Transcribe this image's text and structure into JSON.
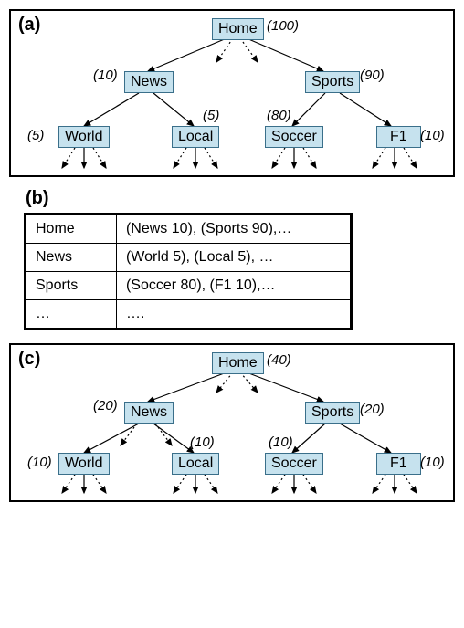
{
  "panels": {
    "a": {
      "label": "(a)",
      "nodes": {
        "home": {
          "text": "Home",
          "annot": "(100)"
        },
        "news": {
          "text": "News",
          "annot": "(10)"
        },
        "sports": {
          "text": "Sports",
          "annot": "(90)"
        },
        "world": {
          "text": "World",
          "annot": "(5)"
        },
        "local": {
          "text": "Local",
          "annot": "(5)"
        },
        "soccer": {
          "text": "Soccer",
          "annot": "(80)"
        },
        "f1": {
          "text": "F1",
          "annot": "(10)"
        }
      }
    },
    "b": {
      "label": "(b)",
      "rows": [
        {
          "key": "Home",
          "val": "(News 10), (Sports 90),…"
        },
        {
          "key": "News",
          "val": "(World 5), (Local 5), …"
        },
        {
          "key": "Sports",
          "val": "(Soccer 80), (F1 10),…"
        },
        {
          "key": "…",
          "val": "…."
        }
      ]
    },
    "c": {
      "label": "(c)",
      "nodes": {
        "home": {
          "text": "Home",
          "annot": "(40)"
        },
        "news": {
          "text": "News",
          "annot": "(20)"
        },
        "sports": {
          "text": "Sports",
          "annot": "(20)"
        },
        "world": {
          "text": "World",
          "annot": "(10)"
        },
        "local": {
          "text": "Local",
          "annot": "(10)"
        },
        "soccer": {
          "text": "Soccer",
          "annot": "(10)"
        },
        "f1": {
          "text": "F1",
          "annot": "(10)"
        }
      }
    }
  }
}
